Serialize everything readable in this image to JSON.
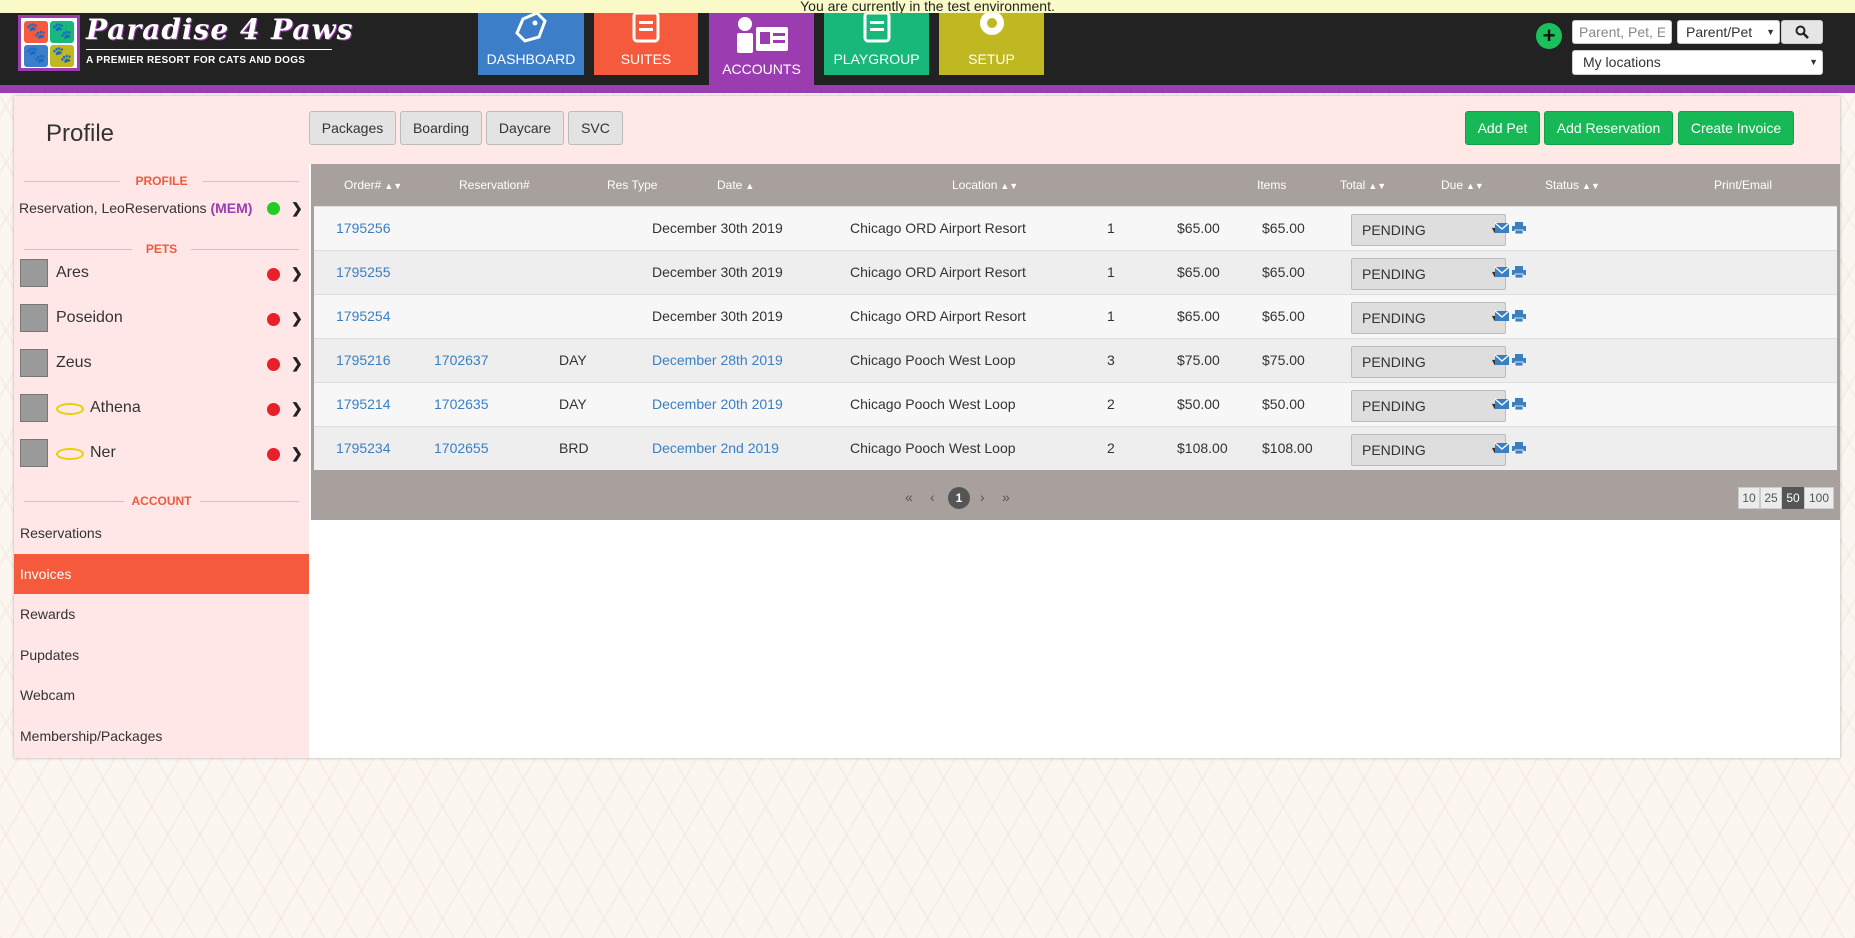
{
  "banner": "You are currently in the test environment.",
  "logo": {
    "title": "Paradise 4 Paws",
    "subtitle": "A PREMIER RESORT FOR CATS AND DOGS"
  },
  "nav": [
    {
      "label": "DASHBOARD",
      "color": "#3d7ec9",
      "icon": "dashboard-tag-icon"
    },
    {
      "label": "SUITES",
      "color": "#f55a3c",
      "icon": "suites-list-icon"
    },
    {
      "label": "ACCOUNTS",
      "color": "#9b3cb0",
      "icon": "accounts-card-icon"
    },
    {
      "label": "PLAYGROUP",
      "color": "#17b87a",
      "icon": "playgroup-list-icon"
    },
    {
      "label": "SETUP",
      "color": "#c0b820",
      "icon": "setup-gear-icon"
    }
  ],
  "search": {
    "placeholder": "Parent, Pet, E",
    "type": "Parent/Pet",
    "location": "My locations"
  },
  "header": {
    "title": "Profile"
  },
  "filters": [
    "Packages",
    "Boarding",
    "Daycare",
    "SVC"
  ],
  "actions": [
    "Add Pet",
    "Add Reservation",
    "Create Invoice"
  ],
  "sidebar": {
    "profile_heading": "PROFILE",
    "profile_name": "Reservation, LeoReservations",
    "profile_badge": "(MEM)",
    "pets_heading": "PETS",
    "pets": [
      {
        "name": "Ares",
        "halo": false
      },
      {
        "name": "Poseidon",
        "halo": false
      },
      {
        "name": "Zeus",
        "halo": false
      },
      {
        "name": "Athena",
        "halo": true
      },
      {
        "name": "Ner",
        "halo": true
      }
    ],
    "account_heading": "ACCOUNT",
    "account_items": [
      "Reservations",
      "Invoices",
      "Rewards",
      "Pupdates",
      "Webcam",
      "Membership/Packages"
    ],
    "active_item": "Invoices"
  },
  "table": {
    "headers": {
      "order": "Order#",
      "reservation": "Reservation#",
      "res_type": "Res Type",
      "date": "Date",
      "location": "Location",
      "items": "Items",
      "total": "Total",
      "due": "Due",
      "status": "Status",
      "print": "Print/Email"
    },
    "rows": [
      {
        "order": "1795256",
        "reservation": "",
        "res_type": "",
        "date": "December 30th 2019",
        "date_link": false,
        "location": "Chicago ORD Airport Resort",
        "items": "1",
        "total": "$65.00",
        "due": "$65.00",
        "status": "PENDING"
      },
      {
        "order": "1795255",
        "reservation": "",
        "res_type": "",
        "date": "December 30th 2019",
        "date_link": false,
        "location": "Chicago ORD Airport Resort",
        "items": "1",
        "total": "$65.00",
        "due": "$65.00",
        "status": "PENDING"
      },
      {
        "order": "1795254",
        "reservation": "",
        "res_type": "",
        "date": "December 30th 2019",
        "date_link": false,
        "location": "Chicago ORD Airport Resort",
        "items": "1",
        "total": "$65.00",
        "due": "$65.00",
        "status": "PENDING"
      },
      {
        "order": "1795216",
        "reservation": "1702637",
        "res_type": "DAY",
        "date": "December 28th 2019",
        "date_link": true,
        "location": "Chicago Pooch West Loop",
        "items": "3",
        "total": "$75.00",
        "due": "$75.00",
        "status": "PENDING"
      },
      {
        "order": "1795214",
        "reservation": "1702635",
        "res_type": "DAY",
        "date": "December 20th 2019",
        "date_link": true,
        "location": "Chicago Pooch West Loop",
        "items": "2",
        "total": "$50.00",
        "due": "$50.00",
        "status": "PENDING"
      },
      {
        "order": "1795234",
        "reservation": "1702655",
        "res_type": "BRD",
        "date": "December 2nd 2019",
        "date_link": true,
        "location": "Chicago Pooch West Loop",
        "items": "2",
        "total": "$108.00",
        "due": "$108.00",
        "status": "PENDING"
      }
    ]
  },
  "pagination": {
    "first": "«",
    "prev": "‹",
    "current": "1",
    "next": "›",
    "last": "»",
    "page_sizes": [
      "10",
      "25",
      "50",
      "100"
    ],
    "selected_size": "50"
  },
  "colors": {
    "accent_green": "#17b956",
    "accent_orange": "#f55a3c",
    "accent_purple": "#9b3cb0",
    "link": "#3a7fc0"
  }
}
